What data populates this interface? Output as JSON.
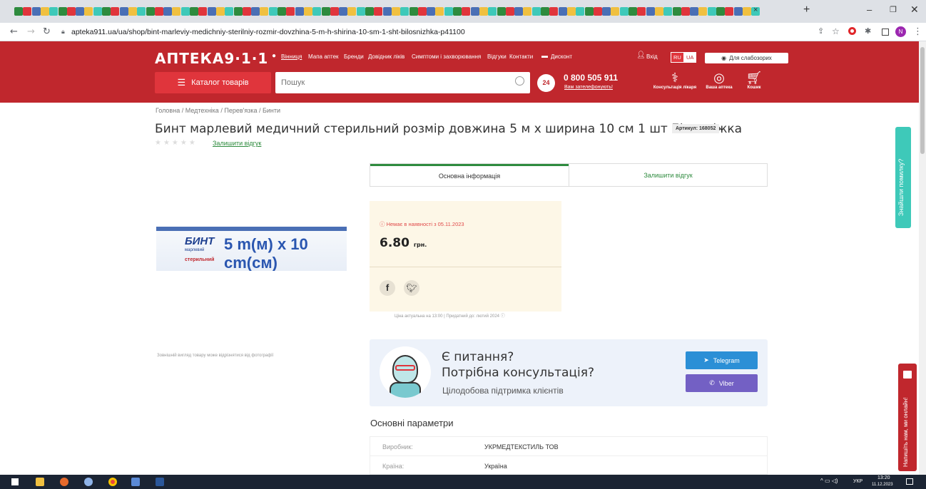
{
  "browser": {
    "url": "apteka911.ua/ua/shop/bint-marleviy-medichniy-sterilniy-rozmir-dovzhina-5-m-h-shirina-10-sm-1-sht-bilosnizhka-p41100",
    "profile_initial": "N"
  },
  "header": {
    "logo": "АПТЕКА9·1·1",
    "city": "Вінниця",
    "nav": [
      "Мапа аптек",
      "Бренди",
      "Довідник ліків",
      "Симптоми і захворювання",
      "Відгуки",
      "Контакти",
      "Дисконт"
    ],
    "login": "Вхід",
    "lang_ru": "RU",
    "lang_ua": "UA",
    "accessibility": "Для слабозорих",
    "catalog": "Каталог товарів",
    "search_placeholder": "Пошук",
    "phone": "0 800 505 911",
    "callback": "Вам зателефонують!",
    "hours_badge": "24",
    "icons": {
      "doctor": "Консультація лікаря",
      "pharmacy": "Ваша аптека",
      "cart": "Кошик"
    }
  },
  "breadcrumb": [
    "Головна",
    "Медтехніка",
    "Перев'язка",
    "Бинти"
  ],
  "product": {
    "title": "Бинт марлевий медичний стерильний розмір довжина 5 м х ширина 10 см 1 шт Білосніжка",
    "sku": "Артикул: 168052",
    "leave_review": "Залишити відгук",
    "rating": 0,
    "tabs": [
      "Основна інформація",
      "Залишити відгук"
    ],
    "image_text": {
      "brand": "БИНТ",
      "sub1": "марлевий",
      "sub2": "медичний",
      "sub3": "стерильний",
      "dim": "5 m(м) x 10 cm(см)"
    },
    "image_note": "Зовнішній вигляд товару може відрізнятися від фотографії",
    "availability": "Немає в наявності з 05.11.2023",
    "price": "6.80",
    "currency": "грн.",
    "price_note": "Ціна актуальна на 13:00 | Придатний до: лютий 2024"
  },
  "consult": {
    "line1": "Є питання?",
    "line2": "Потрібна консультація?",
    "line3": "Цілодобова підтримка клієнтів",
    "telegram": "Telegram",
    "viber": "Viber"
  },
  "params": {
    "title": "Основні параметри",
    "rows": [
      {
        "key": "Виробник:",
        "value": "УКРМЕДТЕКСТИЛЬ ТОВ"
      },
      {
        "key": "Країна:",
        "value": "Україна"
      }
    ]
  },
  "widgets": {
    "report_error": "Знайшли помилку?",
    "chat": "Напишіть нам, ми онлайн!"
  },
  "taskbar": {
    "lang": "УКР",
    "time": "13:20",
    "date": "11.12.2023"
  },
  "colors": {
    "brand_red": "#c0272d",
    "green": "#2e8b3e",
    "telegram": "#2b8fd6",
    "viber": "#7360c4",
    "teal": "#3ec9b9"
  }
}
